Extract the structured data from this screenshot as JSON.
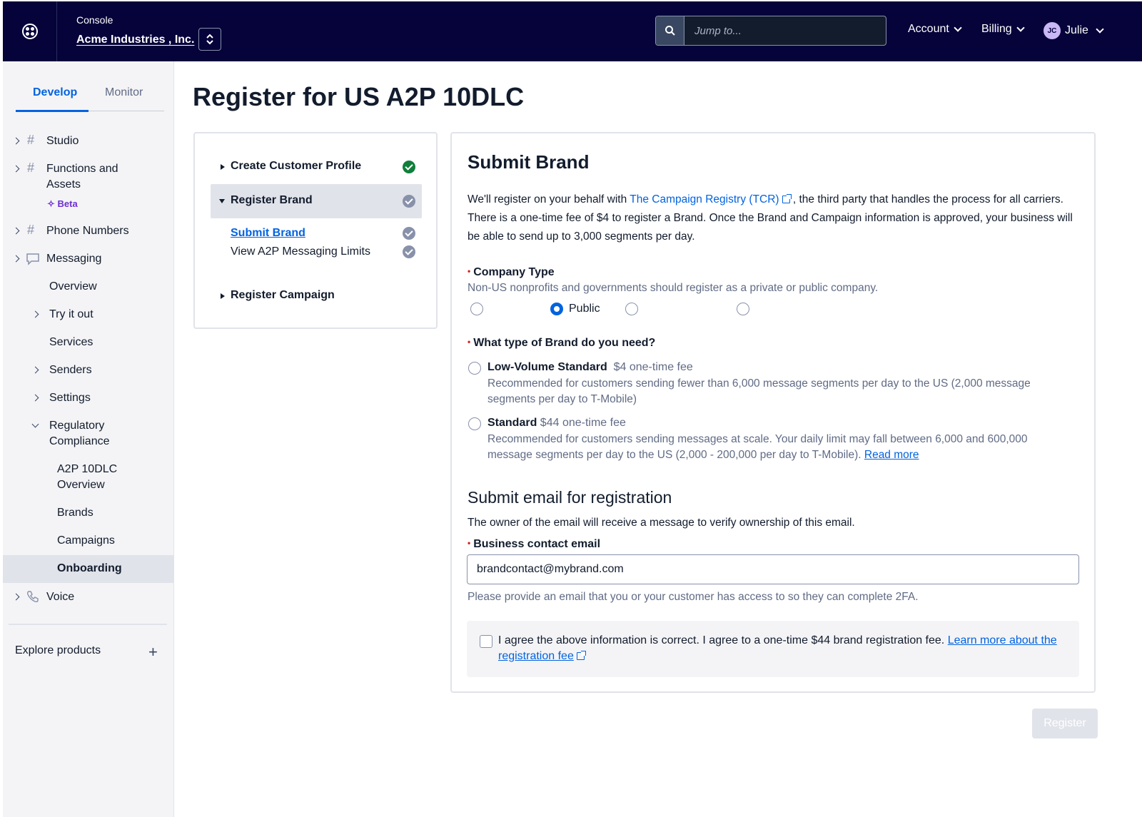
{
  "topbar": {
    "console_label": "Console",
    "account_name": "Acme Industries , Inc.",
    "search_placeholder": "Jump to...",
    "menu_account": "Account",
    "menu_billing": "Billing",
    "user_initials": "JC",
    "user_name": "Julie"
  },
  "sidebar": {
    "tabs": [
      "Develop",
      "Monitor"
    ],
    "active_tab": "Develop",
    "items": {
      "studio": "Studio",
      "functions_line1": "Functions and",
      "functions_line2": "Assets",
      "beta": "Beta",
      "phone_numbers": "Phone Numbers",
      "messaging": "Messaging",
      "overview": "Overview",
      "try_it_out": "Try it out",
      "services": "Services",
      "senders": "Senders",
      "settings": "Settings",
      "regulatory_line1": "Regulatory",
      "regulatory_line2": "Compliance",
      "a2p_line1": "A2P 10DLC",
      "a2p_line2": "Overview",
      "brands": "Brands",
      "campaigns": "Campaigns",
      "onboarding": "Onboarding",
      "voice": "Voice"
    },
    "explore_products": "Explore products"
  },
  "page": {
    "title": "Register for US A2P 10DLC"
  },
  "steps": {
    "create_customer_profile": "Create Customer Profile",
    "register_brand": "Register Brand",
    "submit_brand": "Submit Brand",
    "view_limits": "View A2P Messaging Limits",
    "register_campaign": "Register Campaign"
  },
  "form": {
    "title": "Submit Brand",
    "intro_before": "We'll register on your behalf with ",
    "intro_link": "The Campaign Registry (TCR)",
    "intro_after": " , the third party that handles the process for all carriers. There is a one-time fee of $4 to register a Brand. Once the Brand and Campaign information is approved, your business will be able to send up to 3,000 segments per day.",
    "company_type_label": "Company Type",
    "company_type_help": "Non-US nonprofits and governments should register as a private or public company.",
    "company_type_selected": "Public",
    "brand_type_label": "What type of Brand do you need?",
    "low_volume_title": "Low-Volume Standard",
    "low_volume_fee": "$4 one-time fee",
    "low_volume_desc": "Recommended for customers sending fewer than 6,000 message segments per day to the US (2,000 message segments per day to T-Mobile)",
    "standard_title": "Standard",
    "standard_fee": "$44 one-time fee",
    "standard_desc": "Recommended for customers sending messages at scale. Your daily limit may fall between 6,000 and 600,000 message segments per day to the US (2,000 - 200,000 per day to T-Mobile).",
    "read_more": "Read more",
    "email_section_title": "Submit email for registration",
    "email_section_help": "The owner of the email will receive a message to verify ownership of this email.",
    "email_label": "Business contact email",
    "email_value": "brandcontact@mybrand.com",
    "email_help": "Please provide an email that you or your customer has access to so they can complete 2FA.",
    "agree_text": "I agree the above information is correct. I agree to a one-time $44 brand registration fee. ",
    "agree_link": "Learn more about the registration fee",
    "register_button": "Register"
  },
  "colors": {
    "topbar_bg": "#06033a",
    "link": "#0263e0",
    "required": "#d61f1f",
    "success": "#0f7f3b",
    "beta": "#6d2ed1"
  }
}
